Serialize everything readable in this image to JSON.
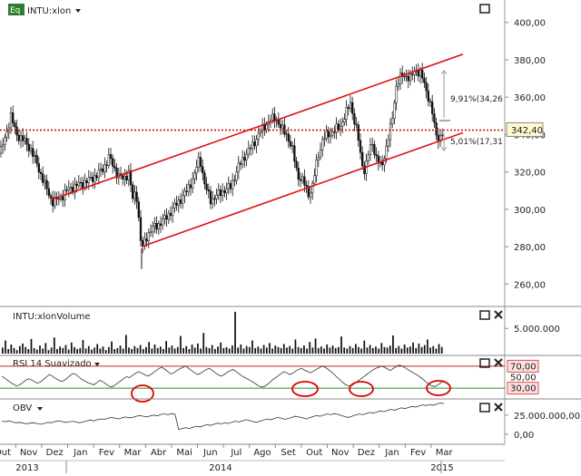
{
  "chart_data": [
    {
      "type": "candlestick",
      "panel": "price",
      "title": "INTU:xlon",
      "title_badge": "Eq",
      "ylim": [
        248,
        412
      ],
      "y_ticks": [
        "400,00",
        "380,00",
        "360,00",
        "340,00",
        "320,00",
        "300,00",
        "280,00",
        "260,00"
      ],
      "y_tick_values": [
        400,
        380,
        360,
        340,
        320,
        300,
        280,
        260
      ],
      "last_price": 342.4,
      "last_price_label": "342,40",
      "path": [
        [
          0,
          330
        ],
        [
          5,
          337
        ],
        [
          12,
          350
        ],
        [
          18,
          340
        ],
        [
          24,
          338
        ],
        [
          34,
          332
        ],
        [
          44,
          320
        ],
        [
          52,
          310
        ],
        [
          58,
          304
        ],
        [
          66,
          306
        ],
        [
          76,
          311
        ],
        [
          86,
          313
        ],
        [
          96,
          315
        ],
        [
          106,
          318
        ],
        [
          114,
          322
        ],
        [
          120,
          328
        ],
        [
          124,
          324
        ],
        [
          130,
          318
        ],
        [
          136,
          316
        ],
        [
          142,
          320
        ],
        [
          146,
          305
        ],
        [
          150,
          310
        ],
        [
          156,
          278
        ],
        [
          162,
          286
        ],
        [
          168,
          290
        ],
        [
          175,
          292
        ],
        [
          182,
          295
        ],
        [
          190,
          300
        ],
        [
          198,
          305
        ],
        [
          206,
          310
        ],
        [
          214,
          318
        ],
        [
          220,
          328
        ],
        [
          226,
          312
        ],
        [
          232,
          305
        ],
        [
          238,
          307
        ],
        [
          246,
          310
        ],
        [
          254,
          312
        ],
        [
          262,
          322
        ],
        [
          270,
          329
        ],
        [
          278,
          334
        ],
        [
          286,
          341
        ],
        [
          292,
          345
        ],
        [
          298,
          348
        ],
        [
          304,
          349
        ],
        [
          310,
          343
        ],
        [
          316,
          340
        ],
        [
          322,
          332
        ],
        [
          328,
          318
        ],
        [
          334,
          315
        ],
        [
          340,
          308
        ],
        [
          344,
          312
        ],
        [
          350,
          328
        ],
        [
          356,
          338
        ],
        [
          362,
          340
        ],
        [
          368,
          342
        ],
        [
          374,
          344
        ],
        [
          380,
          350
        ],
        [
          386,
          357
        ],
        [
          390,
          348
        ],
        [
          394,
          340
        ],
        [
          398,
          326
        ],
        [
          402,
          320
        ],
        [
          406,
          330
        ],
        [
          410,
          336
        ],
        [
          414,
          328
        ],
        [
          420,
          322
        ],
        [
          426,
          334
        ],
        [
          432,
          348
        ],
        [
          436,
          365
        ],
        [
          440,
          370
        ],
        [
          446,
          372
        ],
        [
          452,
          370
        ],
        [
          458,
          375
        ],
        [
          464,
          372
        ],
        [
          468,
          366
        ],
        [
          472,
          360
        ],
        [
          476,
          352
        ],
        [
          480,
          340
        ],
        [
          484,
          338
        ],
        [
          488,
          341
        ]
      ],
      "trend_channel": {
        "upper_line": [
          [
            56,
            305
          ],
          [
            510,
            383
          ]
        ],
        "lower_line": [
          [
            156,
            280
          ],
          [
            510,
            341
          ]
        ]
      },
      "reference_line_value": 342.4,
      "annotations": [
        "9,91%(34,26",
        "5,01%(17,31"
      ]
    },
    {
      "type": "bar",
      "panel": "volume",
      "title": "INTU:xlonVolume",
      "y_ticks": [
        "5.000.000"
      ],
      "y_tick_values": [
        5000000
      ],
      "ylim": [
        0,
        9000000
      ],
      "values": [
        1200000,
        2600000,
        900000,
        1800000,
        1100000,
        700000,
        1500000,
        2000000,
        1300000,
        900000,
        2900000,
        1100000,
        800000,
        1600000,
        1000000,
        2100000,
        700000,
        1200000,
        3200000,
        900000,
        1400000,
        1100000,
        1700000,
        800000,
        2200000,
        1300000,
        900000,
        1100000,
        2700000,
        1000000,
        1500000,
        800000,
        1200000,
        1900000,
        1000000,
        1400000,
        700000,
        1300000,
        2400000,
        900000,
        1100000,
        1600000,
        1000000,
        3700000,
        1200000,
        900000,
        1500000,
        1100000,
        1700000,
        900000,
        1300000,
        2300000,
        1000000,
        1800000,
        1100000,
        1400000,
        900000,
        2500000,
        1200000,
        1600000,
        1000000,
        1300000,
        3500000,
        1100000,
        1500000,
        900000,
        1800000,
        1200000,
        2000000,
        1000000,
        4100000,
        1300000,
        1100000,
        1700000,
        900000,
        1400000,
        2200000,
        1100000,
        1300000,
        1000000,
        1600000,
        8300000,
        1200000,
        1800000,
        1000000,
        1500000,
        1300000,
        2600000,
        1100000,
        1400000,
        1000000,
        1700000,
        1200000,
        2100000,
        1000000,
        1600000,
        1300000,
        1100000,
        1900000,
        1200000,
        1500000,
        1000000,
        2800000,
        1300000,
        1100000,
        1600000,
        1000000,
        2300000,
        1200000,
        3000000,
        1100000,
        1400000,
        1000000,
        1800000,
        1200000,
        1600000,
        1100000,
        1300000,
        3400000,
        1200000,
        1000000,
        1500000,
        1100000,
        1900000,
        1300000,
        1000000,
        2600000,
        1200000,
        1700000,
        1100000,
        1400000,
        1000000,
        2100000,
        1300000,
        1200000,
        1600000,
        3600000,
        1100000,
        1500000,
        1000000,
        1800000,
        1200000,
        1400000,
        2200000,
        1100000,
        2000000,
        1300000,
        1700000,
        2800000,
        1200000,
        1500000,
        1000000,
        1900000,
        1300000
      ]
    },
    {
      "type": "line",
      "panel": "rsi",
      "title": "RSI 14 Suavizado",
      "ylim": [
        12,
        88
      ],
      "levels": [
        70,
        30
      ],
      "level_labels": [
        "70,00",
        "50,00",
        "30,00"
      ],
      "level_values": [
        70,
        50,
        30
      ],
      "values": [
        52,
        48,
        44,
        40,
        37,
        34,
        36,
        40,
        44,
        47,
        45,
        42,
        39,
        41,
        46,
        50,
        55,
        52,
        48,
        45,
        42,
        44,
        48,
        53,
        57,
        55,
        50,
        46,
        43,
        40,
        38,
        36,
        40,
        44,
        42,
        38,
        34,
        32,
        35,
        39,
        43,
        47,
        51,
        49,
        53,
        57,
        60,
        58,
        55,
        52,
        54,
        58,
        62,
        66,
        68,
        64,
        60,
        56,
        58,
        62,
        65,
        68,
        70,
        66,
        62,
        58,
        55,
        57,
        61,
        64,
        66,
        62,
        58,
        54,
        52,
        55,
        59,
        62,
        64,
        60,
        56,
        52,
        49,
        46,
        43,
        40,
        36,
        33,
        32,
        35,
        39,
        44,
        48,
        52,
        56,
        60,
        58,
        55,
        57,
        61,
        64,
        66,
        63,
        60,
        58,
        61,
        64,
        67,
        70,
        68,
        64,
        60,
        55,
        50,
        45,
        40,
        36,
        34,
        35,
        39,
        43,
        47,
        51,
        55,
        59,
        63,
        66,
        68,
        70,
        68,
        65,
        62,
        66,
        70,
        72,
        70,
        67,
        63,
        60,
        57,
        54,
        50,
        46,
        41,
        37,
        34,
        33,
        36,
        40,
        44
      ],
      "highlighted_regions": [
        "Abr",
        "Out",
        "Dez",
        "Mar"
      ]
    },
    {
      "type": "line",
      "panel": "obv",
      "title": "OBV",
      "ylim": [
        -12000000,
        45000000
      ],
      "y_ticks": [
        "25.000.000,00",
        "0,00"
      ],
      "y_tick_values": [
        25000000,
        0
      ],
      "values": [
        17000000,
        16500000,
        17500000,
        16000000,
        15000000,
        15500000,
        14500000,
        13500000,
        14500000,
        15000000,
        14000000,
        13000000,
        14000000,
        15500000,
        15000000,
        16500000,
        17500000,
        16500000,
        15500000,
        16000000,
        17000000,
        16000000,
        15000000,
        16000000,
        17500000,
        18500000,
        17500000,
        19000000,
        20000000,
        19500000,
        21000000,
        22000000,
        21000000,
        20000000,
        21500000,
        22500000,
        21500000,
        22000000,
        23500000,
        24500000,
        23500000,
        22500000,
        24000000,
        25000000,
        24000000,
        26000000,
        26500000,
        25500000,
        27000000,
        26000000,
        6000000,
        7500000,
        8500000,
        7500000,
        9000000,
        10500000,
        9500000,
        11000000,
        12500000,
        11500000,
        13000000,
        14500000,
        13500000,
        15000000,
        14000000,
        15500000,
        17000000,
        16000000,
        17500000,
        19000000,
        18000000,
        16500000,
        15500000,
        17000000,
        18500000,
        20000000,
        19000000,
        20500000,
        22000000,
        21000000,
        19500000,
        20500000,
        22000000,
        23500000,
        22500000,
        21500000,
        20000000,
        21500000,
        23000000,
        24500000,
        23500000,
        25000000,
        26500000,
        25500000,
        27000000,
        26000000,
        24500000,
        23000000,
        22000000,
        23500000,
        25000000,
        26500000,
        25500000,
        27000000,
        28500000,
        27500000,
        29000000,
        30500000,
        29500000,
        31000000,
        32500000,
        31500000,
        33000000,
        34500000,
        33500000,
        35000000,
        36500000,
        35500000,
        37000000,
        38500000,
        37500000,
        39000000,
        38000000,
        39500000,
        41000000,
        40000000
      ],
      "time_axis": {
        "months": [
          "Out",
          "Nov",
          "Dez",
          "Jan",
          "Fev",
          "Mar",
          "Abr",
          "Mai",
          "Jun",
          "Jul",
          "Ago",
          "Set",
          "Out",
          "Nov",
          "Dez",
          "Jan",
          "Fev",
          "Mar"
        ],
        "years": [
          "2013",
          "2014",
          "2015"
        ]
      }
    }
  ]
}
